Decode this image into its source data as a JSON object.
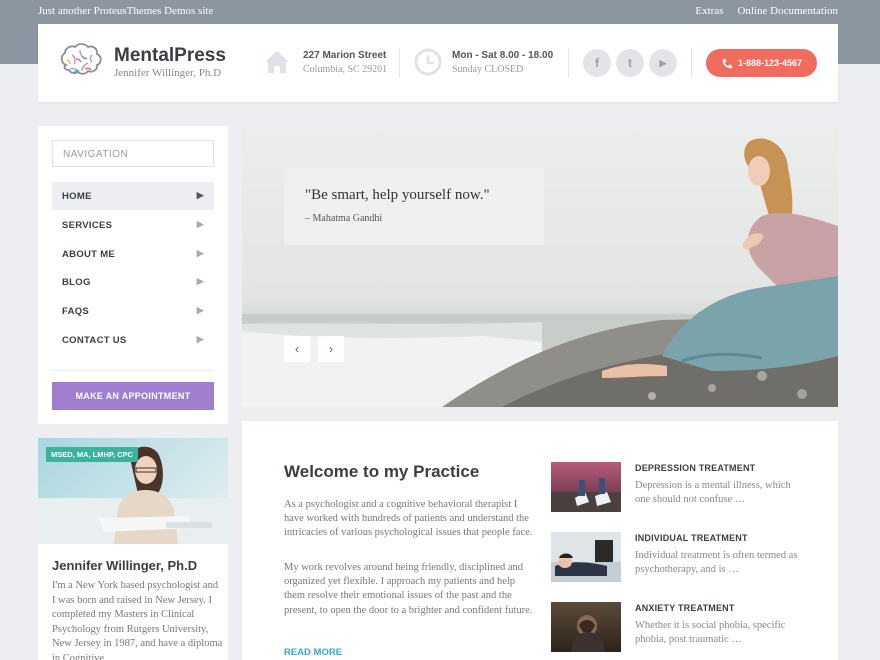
{
  "topbar": {
    "tagline": "Just another ProteusThemes Demos site",
    "links": [
      "Extras",
      "Online Documentation"
    ]
  },
  "header": {
    "logo_title": "MentalPress",
    "logo_subtitle": "Jennifer Willinger, Ph.D",
    "address": {
      "line1": "227 Marion Street",
      "line2": "Columbia, SC 29201",
      "icon": "home-icon"
    },
    "hours": {
      "line1": "Mon - Sat 8.00 - 18.00",
      "line2": "Sunday CLOSED",
      "icon": "clock-icon"
    },
    "social": [
      {
        "name": "facebook-icon",
        "glyph": "f"
      },
      {
        "name": "twitter-icon",
        "glyph": "t"
      },
      {
        "name": "youtube-icon",
        "glyph": "▶"
      }
    ],
    "phone": "1-888-123-4567"
  },
  "sidebar": {
    "heading": "NAVIGATION",
    "items": [
      {
        "label": "HOME",
        "active": true
      },
      {
        "label": "SERVICES"
      },
      {
        "label": "ABOUT ME"
      },
      {
        "label": "BLOG"
      },
      {
        "label": "FAQS"
      },
      {
        "label": "CONTACT US"
      }
    ],
    "cta": "MAKE AN APPOINTMENT"
  },
  "slider": {
    "quote": "\"Be smart, help yourself now.\"",
    "author": "– Mahatma Gandhi",
    "prev": "‹",
    "next": "›"
  },
  "profile": {
    "badge": "MSED, MA, LMHP, CPC",
    "name": "Jennifer Willinger, Ph.D",
    "bio": "I'm a New York based psychologist and I was born and raised in New Jersey. I completed my Masters in Clinical Psychology from Rutgers University, New Jersey in 1987, and have a diploma in Cognitive"
  },
  "welcome": {
    "title": "Welcome to my Practice",
    "p1": "As a psychologist and a cognitive behavioral therapist I have worked with hundreds of patients and understand the intricacies of various psychological issues that people face.",
    "p2": "My work revolves around being friendly, disciplined and organized yet flexible. I approach my patients and help them resolve their emotional issues of the past and the present, to open the door to a brighter and confident future.",
    "read_more": "READ MORE"
  },
  "services": [
    {
      "title": "DEPRESSION TREATMENT",
      "text": "Depression is a mental illness, which one should not confuse …"
    },
    {
      "title": "INDIVIDUAL TREATMENT",
      "text": "Individual treatment is often termed as psychotherapy, and is …"
    },
    {
      "title": "ANXIETY TREATMENT",
      "text": "Whether it is social phobia, specific phobia, post traumatic …"
    }
  ],
  "colors": {
    "accent_purple": "#a07ecf",
    "phone_red": "#ef6c5e",
    "link_blue": "#38a8c0",
    "badge_green": "#3bb39a",
    "topbar": "#8c96a1"
  }
}
